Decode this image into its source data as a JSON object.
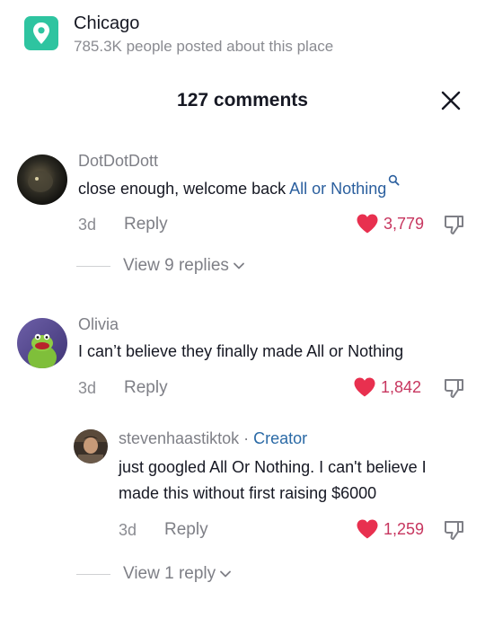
{
  "location": {
    "title": "Chicago",
    "subtitle": "785.3K people posted about this place",
    "icon": "location-pin-icon",
    "icon_color": "#2ec4a0"
  },
  "header": {
    "title": "127 comments",
    "close_icon": "close-icon"
  },
  "comments": [
    {
      "username": "DotDotDott",
      "text_before": "close enough, welcome back ",
      "link_text": "All or Nothing",
      "time": "3d",
      "reply_label": "Reply",
      "likes": "3,779",
      "view_replies": "View 9 replies"
    },
    {
      "username": "Olivia",
      "text": "I can’t believe they finally made All or Nothing",
      "time": "3d",
      "reply_label": "Reply",
      "likes": "1,842"
    }
  ],
  "reply": {
    "username": "stevenhaastiktok",
    "separator": " · ",
    "badge": "Creator",
    "text_line1": "just googled All Or Nothing. I can't believe I",
    "text_line2": "made this without first raising $6000",
    "time": "3d",
    "reply_label": "Reply",
    "likes": "1,259",
    "view_replies": "View 1 reply"
  },
  "colors": {
    "like_red": "#e8304f",
    "link_blue": "#2b5f9e",
    "muted": "#8a8b91"
  }
}
